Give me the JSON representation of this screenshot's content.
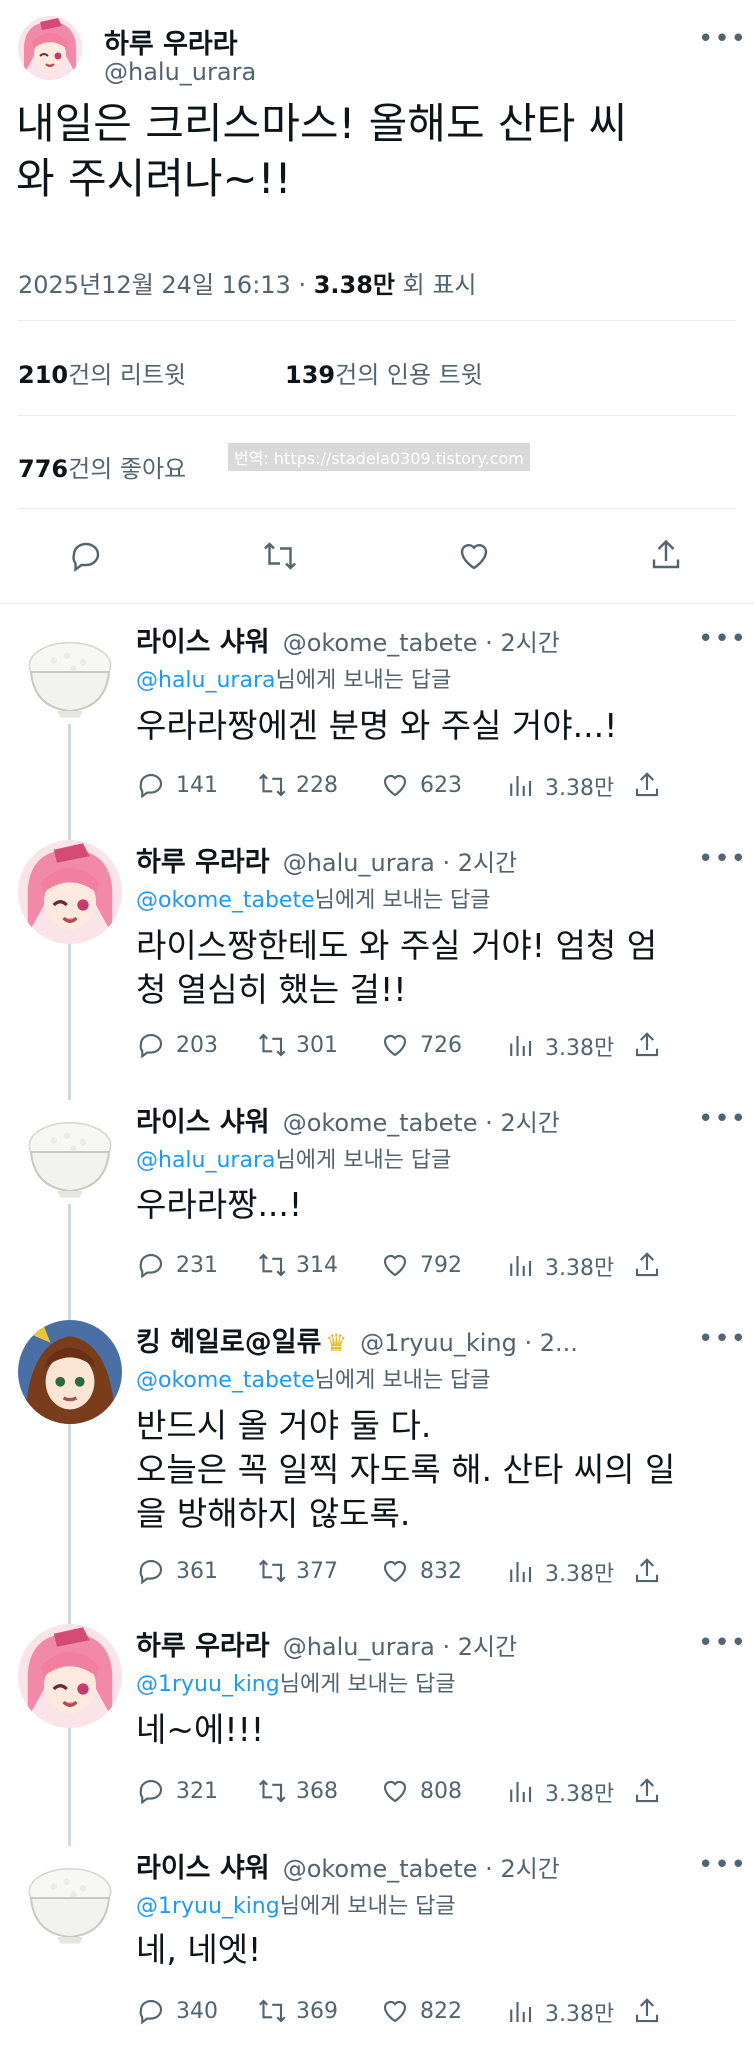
{
  "main": {
    "name": "하루 우라라",
    "handle": "@halu_urara",
    "text": "내일은 크리스마스! 올해도 산타 씨\n와 주시려나~!!",
    "date": "2025년12월 24일  16:13 · ",
    "views": "3.38만",
    "views_label": " 회 표시",
    "retweets": "210",
    "retweets_label": "건의 리트윗",
    "quotes": "139",
    "quotes_label": "건의 인용 트윗",
    "likes": "776",
    "likes_label": "건의 좋아요",
    "watermark": "번역: https://stadela0309.tistory.com",
    "more": "•••"
  },
  "replies": [
    {
      "name": "라이스 샤워",
      "handle": "@okome_tabete · 2시간",
      "reply_to": "@halu_urara",
      "reply_suffix": "님에게 보내는 답글",
      "text": "우라라짱에겐 분명 와 주실 거야...!",
      "comments": "141",
      "retweets": "228",
      "likes": "623",
      "views": "3.38만",
      "avatar": "rice-bowl"
    },
    {
      "name": "하루 우라라",
      "handle": "@halu_urara · 2시간",
      "reply_to": "@okome_tabete",
      "reply_suffix": "님에게 보내는 답글",
      "text": "라이스짱한테도 와 주실 거야! 엄청 엄\n청 열심히 했는  걸!!",
      "comments": "203",
      "retweets": "301",
      "likes": "726",
      "views": "3.38만",
      "avatar": "urara"
    },
    {
      "name": "라이스 샤워",
      "handle": "@okome_tabete · 2시간",
      "reply_to": "@halu_urara",
      "reply_suffix": "님에게 보내는 답글",
      "text": "우라라짱...!",
      "comments": "231",
      "retweets": "314",
      "likes": "792",
      "views": "3.38만",
      "avatar": "rice-bowl"
    },
    {
      "name": "킹 헤일로@일류",
      "handle": "@1ryuu_king · 2...",
      "reply_to": "@okome_tabete",
      "reply_suffix": "님에게 보내는 답글",
      "text": "반드시 올 거야 둘 다.\n오늘은 꼭 일찍 자도록 해. 산타 씨의 일\n을 방해하지 않도록.",
      "comments": "361",
      "retweets": "377",
      "likes": "832",
      "views": "3.38만",
      "avatar": "king"
    },
    {
      "name": "하루 우라라",
      "handle": "@halu_urara · 2시간",
      "reply_to": "@1ryuu_king",
      "reply_suffix": "님에게 보내는 답글",
      "text": "네~에!!!",
      "comments": "321",
      "retweets": "368",
      "likes": "808",
      "views": "3.38만",
      "avatar": "urara"
    },
    {
      "name": "라이스 샤워",
      "handle": "@okome_tabete · 2시간",
      "reply_to": "@1ryuu_king",
      "reply_suffix": "님에게 보내는 답글",
      "text": "네, 네엣!",
      "comments": "340",
      "retweets": "369",
      "likes": "822",
      "views": "3.38만",
      "avatar": "rice-bowl"
    }
  ],
  "colors": {
    "link": "#1d9bf0",
    "muted": "#536471",
    "crown": "#e8b923"
  }
}
